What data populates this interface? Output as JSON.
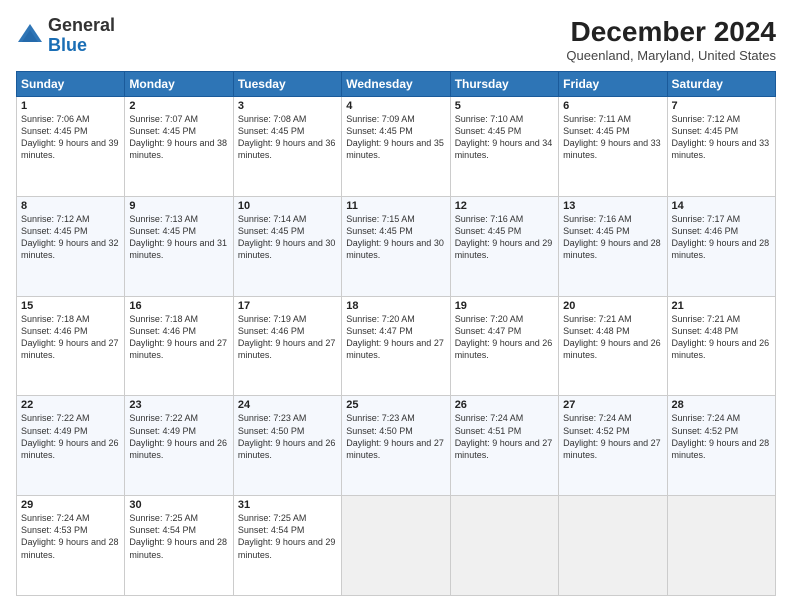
{
  "header": {
    "logo_general": "General",
    "logo_blue": "Blue",
    "main_title": "December 2024",
    "subtitle": "Queenland, Maryland, United States"
  },
  "calendar": {
    "days_of_week": [
      "Sunday",
      "Monday",
      "Tuesday",
      "Wednesday",
      "Thursday",
      "Friday",
      "Saturday"
    ],
    "weeks": [
      [
        null,
        null,
        null,
        null,
        null,
        null,
        null
      ]
    ]
  },
  "cells": {
    "w1": [
      null,
      null,
      null,
      null,
      null,
      null,
      null
    ]
  },
  "days": {
    "d1": {
      "num": "1",
      "rise": "Sunrise: 7:06 AM",
      "set": "Sunset: 4:45 PM",
      "day": "Daylight: 9 hours and 39 minutes."
    },
    "d2": {
      "num": "2",
      "rise": "Sunrise: 7:07 AM",
      "set": "Sunset: 4:45 PM",
      "day": "Daylight: 9 hours and 38 minutes."
    },
    "d3": {
      "num": "3",
      "rise": "Sunrise: 7:08 AM",
      "set": "Sunset: 4:45 PM",
      "day": "Daylight: 9 hours and 36 minutes."
    },
    "d4": {
      "num": "4",
      "rise": "Sunrise: 7:09 AM",
      "set": "Sunset: 4:45 PM",
      "day": "Daylight: 9 hours and 35 minutes."
    },
    "d5": {
      "num": "5",
      "rise": "Sunrise: 7:10 AM",
      "set": "Sunset: 4:45 PM",
      "day": "Daylight: 9 hours and 34 minutes."
    },
    "d6": {
      "num": "6",
      "rise": "Sunrise: 7:11 AM",
      "set": "Sunset: 4:45 PM",
      "day": "Daylight: 9 hours and 33 minutes."
    },
    "d7": {
      "num": "7",
      "rise": "Sunrise: 7:12 AM",
      "set": "Sunset: 4:45 PM",
      "day": "Daylight: 9 hours and 33 minutes."
    },
    "d8": {
      "num": "8",
      "rise": "Sunrise: 7:12 AM",
      "set": "Sunset: 4:45 PM",
      "day": "Daylight: 9 hours and 32 minutes."
    },
    "d9": {
      "num": "9",
      "rise": "Sunrise: 7:13 AM",
      "set": "Sunset: 4:45 PM",
      "day": "Daylight: 9 hours and 31 minutes."
    },
    "d10": {
      "num": "10",
      "rise": "Sunrise: 7:14 AM",
      "set": "Sunset: 4:45 PM",
      "day": "Daylight: 9 hours and 30 minutes."
    },
    "d11": {
      "num": "11",
      "rise": "Sunrise: 7:15 AM",
      "set": "Sunset: 4:45 PM",
      "day": "Daylight: 9 hours and 30 minutes."
    },
    "d12": {
      "num": "12",
      "rise": "Sunrise: 7:16 AM",
      "set": "Sunset: 4:45 PM",
      "day": "Daylight: 9 hours and 29 minutes."
    },
    "d13": {
      "num": "13",
      "rise": "Sunrise: 7:16 AM",
      "set": "Sunset: 4:45 PM",
      "day": "Daylight: 9 hours and 28 minutes."
    },
    "d14": {
      "num": "14",
      "rise": "Sunrise: 7:17 AM",
      "set": "Sunset: 4:46 PM",
      "day": "Daylight: 9 hours and 28 minutes."
    },
    "d15": {
      "num": "15",
      "rise": "Sunrise: 7:18 AM",
      "set": "Sunset: 4:46 PM",
      "day": "Daylight: 9 hours and 27 minutes."
    },
    "d16": {
      "num": "16",
      "rise": "Sunrise: 7:18 AM",
      "set": "Sunset: 4:46 PM",
      "day": "Daylight: 9 hours and 27 minutes."
    },
    "d17": {
      "num": "17",
      "rise": "Sunrise: 7:19 AM",
      "set": "Sunset: 4:46 PM",
      "day": "Daylight: 9 hours and 27 minutes."
    },
    "d18": {
      "num": "18",
      "rise": "Sunrise: 7:20 AM",
      "set": "Sunset: 4:47 PM",
      "day": "Daylight: 9 hours and 27 minutes."
    },
    "d19": {
      "num": "19",
      "rise": "Sunrise: 7:20 AM",
      "set": "Sunset: 4:47 PM",
      "day": "Daylight: 9 hours and 26 minutes."
    },
    "d20": {
      "num": "20",
      "rise": "Sunrise: 7:21 AM",
      "set": "Sunset: 4:48 PM",
      "day": "Daylight: 9 hours and 26 minutes."
    },
    "d21": {
      "num": "21",
      "rise": "Sunrise: 7:21 AM",
      "set": "Sunset: 4:48 PM",
      "day": "Daylight: 9 hours and 26 minutes."
    },
    "d22": {
      "num": "22",
      "rise": "Sunrise: 7:22 AM",
      "set": "Sunset: 4:49 PM",
      "day": "Daylight: 9 hours and 26 minutes."
    },
    "d23": {
      "num": "23",
      "rise": "Sunrise: 7:22 AM",
      "set": "Sunset: 4:49 PM",
      "day": "Daylight: 9 hours and 26 minutes."
    },
    "d24": {
      "num": "24",
      "rise": "Sunrise: 7:23 AM",
      "set": "Sunset: 4:50 PM",
      "day": "Daylight: 9 hours and 26 minutes."
    },
    "d25": {
      "num": "25",
      "rise": "Sunrise: 7:23 AM",
      "set": "Sunset: 4:50 PM",
      "day": "Daylight: 9 hours and 27 minutes."
    },
    "d26": {
      "num": "26",
      "rise": "Sunrise: 7:24 AM",
      "set": "Sunset: 4:51 PM",
      "day": "Daylight: 9 hours and 27 minutes."
    },
    "d27": {
      "num": "27",
      "rise": "Sunrise: 7:24 AM",
      "set": "Sunset: 4:52 PM",
      "day": "Daylight: 9 hours and 27 minutes."
    },
    "d28": {
      "num": "28",
      "rise": "Sunrise: 7:24 AM",
      "set": "Sunset: 4:52 PM",
      "day": "Daylight: 9 hours and 28 minutes."
    },
    "d29": {
      "num": "29",
      "rise": "Sunrise: 7:24 AM",
      "set": "Sunset: 4:53 PM",
      "day": "Daylight: 9 hours and 28 minutes."
    },
    "d30": {
      "num": "30",
      "rise": "Sunrise: 7:25 AM",
      "set": "Sunset: 4:54 PM",
      "day": "Daylight: 9 hours and 28 minutes."
    },
    "d31": {
      "num": "31",
      "rise": "Sunrise: 7:25 AM",
      "set": "Sunset: 4:54 PM",
      "day": "Daylight: 9 hours and 29 minutes."
    }
  }
}
